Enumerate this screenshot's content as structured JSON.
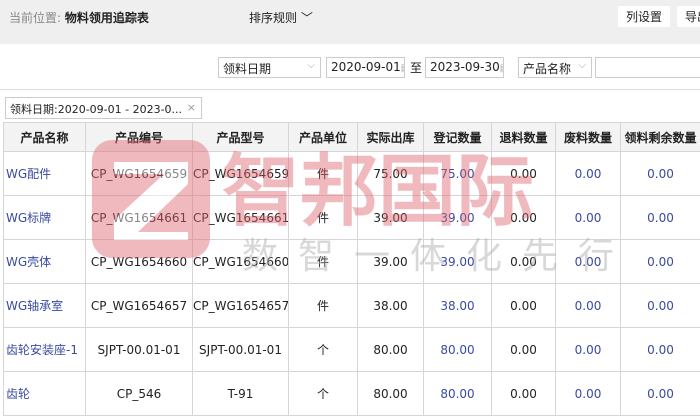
{
  "header": {
    "location_label": "当前位置:",
    "location_value": "物料领用追踪表",
    "sort_label": "排序规则",
    "column_settings": "列设置",
    "export": "导出"
  },
  "filters": {
    "date_type": "领料日期",
    "start_date": "2020-09-01",
    "to": "至",
    "end_date": "2023-09-30",
    "field_select": "产品名称",
    "search_value": ""
  },
  "active_filter": "领料日期:2020-09-01 - 2023-0...",
  "table": {
    "columns": [
      "产品名称",
      "产品编号",
      "产品型号",
      "产品单位",
      "实际出库",
      "登记数量",
      "退料数量",
      "废料数量",
      "领料剩余数量"
    ],
    "rows": [
      [
        "WG配件",
        "CP_WG1654659",
        "CP_WG1654659",
        "件",
        "75.00",
        "75.00",
        "0.00",
        "0.00",
        "0.00"
      ],
      [
        "WG标牌",
        "CP_WG1654661",
        "CP_WG1654661",
        "件",
        "39.00",
        "39.00",
        "0.00",
        "0.00",
        "0.00"
      ],
      [
        "WG壳体",
        "CP_WG1654660",
        "CP_WG1654660",
        "件",
        "39.00",
        "39.00",
        "0.00",
        "0.00",
        "0.00"
      ],
      [
        "WG轴承室",
        "CP_WG1654657",
        "CP_WG1654657",
        "件",
        "38.00",
        "38.00",
        "0.00",
        "0.00",
        "0.00"
      ],
      [
        "齿轮安装座-1",
        "SJPT-00.01-01",
        "SJPT-00.01-01",
        "个",
        "80.00",
        "80.00",
        "0.00",
        "0.00",
        "0.00"
      ],
      [
        "齿轮",
        "CP_546",
        "T-91",
        "个",
        "80.00",
        "80.00",
        "0.00",
        "0.00",
        "0.00"
      ]
    ]
  },
  "watermark": {
    "brand": "智邦国际",
    "slogan": "数智一体化先行者",
    "color": "#e06670"
  }
}
